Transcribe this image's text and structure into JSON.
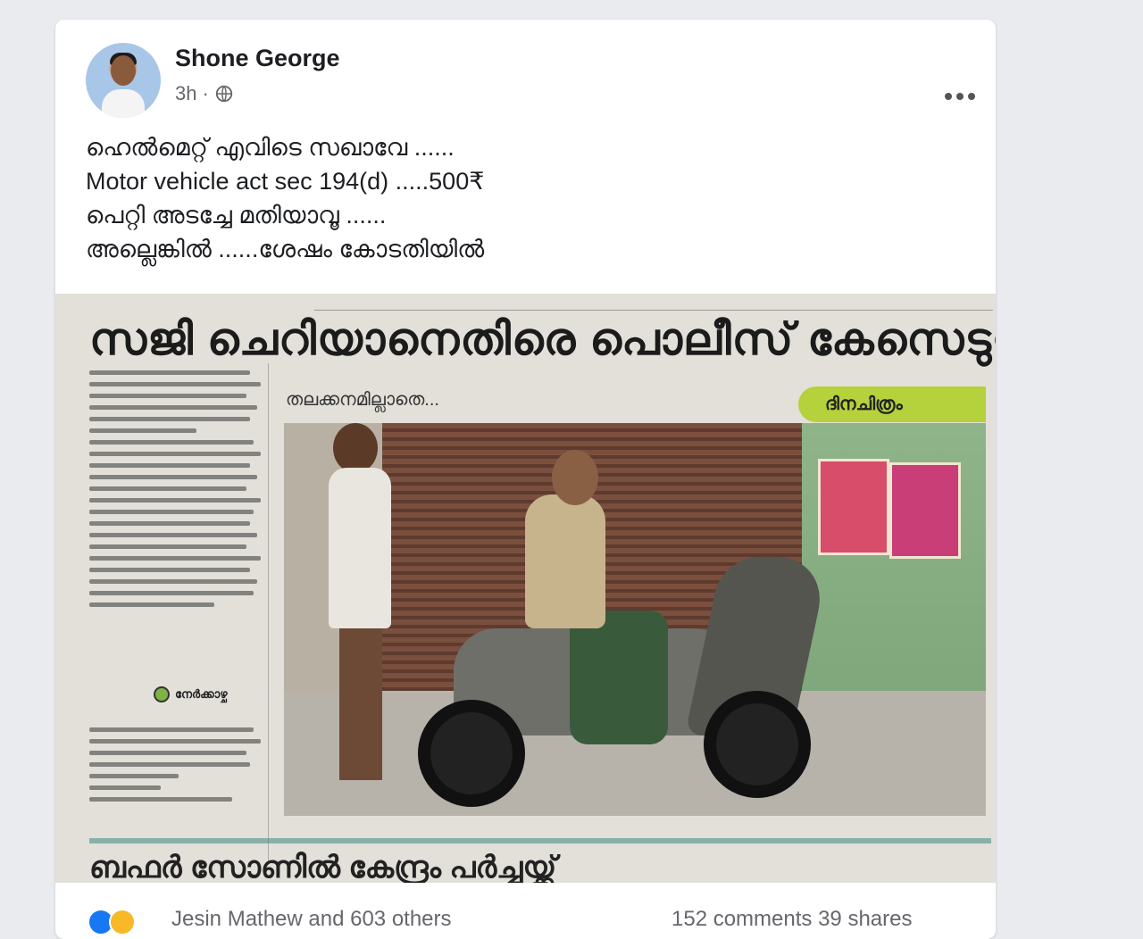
{
  "post": {
    "author": "Shone George",
    "time": "3h",
    "separator": "·",
    "privacy_icon": "globe-icon",
    "more_icon": "more-dots-icon",
    "lines": [
      "ഹെൽമെറ്റ് എവിടെ സഖാവേ ......",
      "Motor vehicle act sec 194(d) .....500₹",
      "പെറ്റി അടച്ചേ മതിയാവൂ ......",
      "അല്ലെങ്കിൽ ......ശേഷം കോടതിയിൽ"
    ]
  },
  "newspaper": {
    "headline": "സജി ചെറിയാനെതിരെ പൊലീസ് കേസെടുത്തു",
    "caption": "തലക്കനമില്ലാതെ...",
    "brand": "ദിനചിത്രം",
    "column_tag": "നേർക്കാഴ്ച",
    "bottom_headline": "ബഫർ സോണിൽ കേന്ദ്രം പർച്ചയ്ക്ക്"
  },
  "reactions": {
    "names": "Jesin Mathew and 603 others",
    "stats": "152 comments 39 shares",
    "colors": {
      "like": "#1877f2",
      "haha": "#f7b928"
    }
  }
}
